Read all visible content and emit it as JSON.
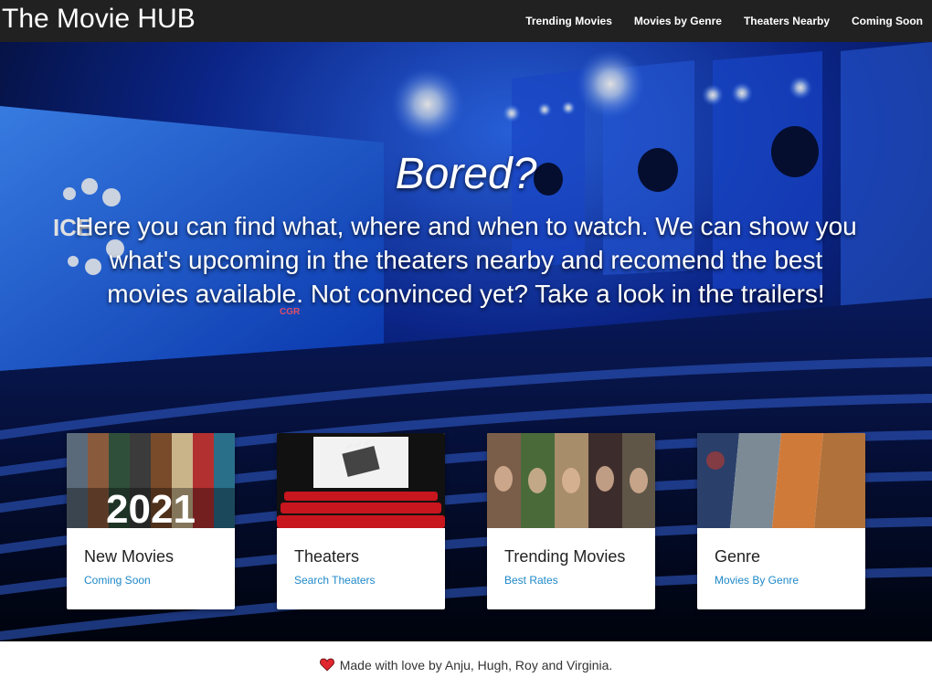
{
  "navbar": {
    "brand": "The Movie HUB",
    "links": [
      "Trending Movies",
      "Movies by Genre",
      "Theaters Nearby",
      "Coming Soon"
    ]
  },
  "hero": {
    "title": "Bored?",
    "subtitle": "Here you can find what, where and when to watch. We can show you what's upcoming in the theaters nearby and recomend the best movies available. Not convinced yet? Take a look in the trailers!",
    "screen_logo": "ICE",
    "screen_logo_small": "CGR"
  },
  "cards": [
    {
      "title": "New Movies",
      "link": "Coming Soon",
      "image_text": "2021"
    },
    {
      "title": "Theaters",
      "link": "Search Theaters"
    },
    {
      "title": "Trending Movies",
      "link": "Best Rates"
    },
    {
      "title": "Genre",
      "link": "Movies By Genre"
    }
  ],
  "footer": {
    "text": "Made with love by Anju, Hugh, Roy and Virginia."
  },
  "colors": {
    "navbar_bg": "#212121",
    "link_blue": "#1e88c8",
    "heart_red": "#e0262f",
    "theater_blue": "#1a4fd8"
  }
}
